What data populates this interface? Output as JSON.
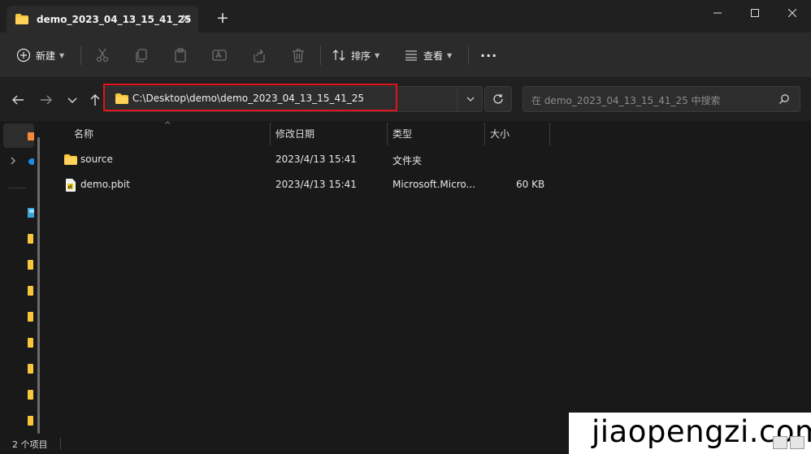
{
  "tab": {
    "title": "demo_2023_04_13_15_41_25",
    "close_glyph": "✕",
    "new_tab_glyph": "+"
  },
  "window": {
    "minimize_icon": "minimize-icon",
    "maximize_icon": "maximize-icon",
    "close_icon": "close-icon"
  },
  "toolbar": {
    "new_label": "新建",
    "sort_label": "排序",
    "view_label": "查看",
    "more_glyph": "···",
    "icons": [
      "cut-icon",
      "copy-icon",
      "paste-icon",
      "rename-icon",
      "share-icon",
      "delete-icon"
    ]
  },
  "address": {
    "path": "C:\\Desktop\\demo\\demo_2023_04_13_15_41_25",
    "search_placeholder": "在 demo_2023_04_13_15_41_25 中搜索"
  },
  "columns": {
    "name": "名称",
    "modified": "修改日期",
    "type": "类型",
    "size": "大小"
  },
  "files": [
    {
      "name": "source",
      "modified": "2023/4/13 15:41",
      "type": "文件夹",
      "size": "",
      "icon": "folder-icon"
    },
    {
      "name": "demo.pbit",
      "modified": "2023/4/13 15:41",
      "type": "Microsoft.Micro...",
      "size": "60 KB",
      "icon": "pbit-file-icon"
    }
  ],
  "status": {
    "count_text": "2 个项目"
  },
  "watermark": {
    "text": "jiaopengzi.com"
  },
  "colors": {
    "accent_folder": "#f8c63a",
    "highlight_border": "#e0141a"
  }
}
